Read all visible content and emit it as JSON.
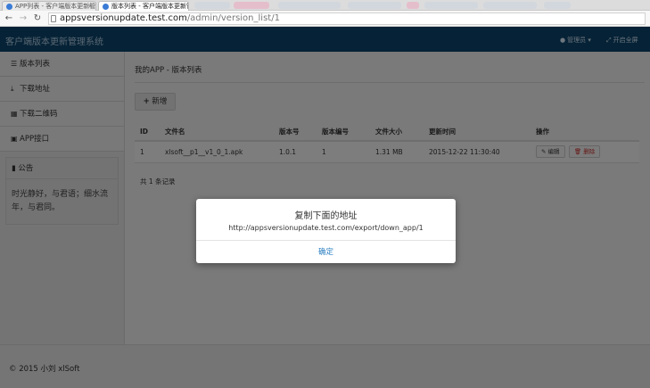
{
  "browser": {
    "tabs": [
      {
        "label": "APP列表 - 客户端版本更新管..."
      },
      {
        "label": "版本列表 - 客户端版本更新管理..."
      }
    ],
    "close_glyph": "×",
    "url_host": "appsversionupdate.test.com",
    "url_path": "/admin/version_list/1"
  },
  "header": {
    "brand": "客户端版本更新管理系统",
    "user_label": "管理员",
    "fullscreen_label": "开启全屏"
  },
  "sidebar": {
    "items": [
      {
        "label": "版本列表",
        "icon": "list-icon"
      },
      {
        "label": "下载地址",
        "icon": "download-icon"
      },
      {
        "label": "下载二维码",
        "icon": "qrcode-icon"
      },
      {
        "label": "APP接口",
        "icon": "cube-icon"
      }
    ],
    "notice": {
      "title": "公告",
      "line1": "时光静好，与君语；细水流",
      "line2": "年，与君同。"
    }
  },
  "main": {
    "breadcrumb": "我的APP - 版本列表",
    "add_label": "新增",
    "table": {
      "headers": [
        "ID",
        "文件名",
        "版本号",
        "版本编号",
        "文件大小",
        "更新时间",
        "操作"
      ],
      "rows": [
        {
          "id": "1",
          "filename": "xlsoft__p1__v1_0_1.apk",
          "version": "1.0.1",
          "code": "1",
          "size": "1.31 MB",
          "updated": "2015-12-22 11:30:40"
        }
      ],
      "edit_label": "编辑",
      "delete_label": "删除"
    },
    "total": "共 1 条记录"
  },
  "footer": {
    "text": "© 2015 小刘 xlSoft"
  },
  "modal": {
    "title": "复制下面的地址",
    "message": "http://appsversionupdate.test.com/export/down_app/1",
    "ok_label": "确定"
  }
}
